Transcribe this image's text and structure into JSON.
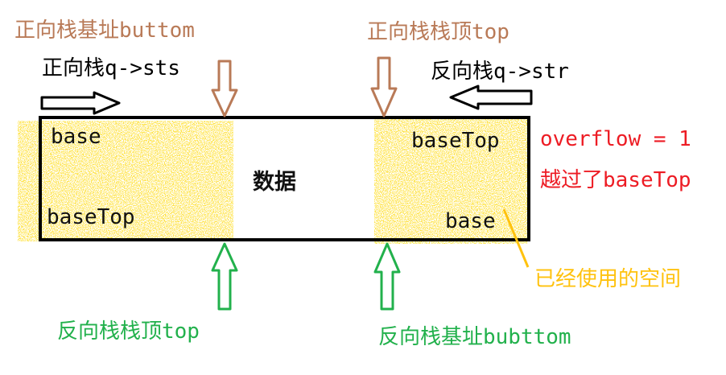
{
  "labels": {
    "forward_base": "正向栈基址buttom",
    "forward_top": "正向栈栈顶top",
    "forward_stack": "正向栈q->sts",
    "reverse_stack": "反向栈q->str",
    "reverse_top": "反向栈栈顶top",
    "reverse_base": "反向栈基址bubttom",
    "overflow": "overflow = 1",
    "crossed": "越过了baseTop",
    "used_space": "已经使用的空间",
    "data": "数据",
    "left_base": "base",
    "left_baseTop": "baseTop",
    "right_baseTop": "baseTop",
    "right_base": "base"
  },
  "colors": {
    "brown": "#b97a57",
    "green": "#22b14c",
    "red": "#ed1c24",
    "gold": "#ffc20e",
    "black": "#000000"
  },
  "icons": [
    "right-arrow-icon",
    "left-arrow-icon",
    "down-arrow-icon",
    "up-arrow-icon"
  ]
}
